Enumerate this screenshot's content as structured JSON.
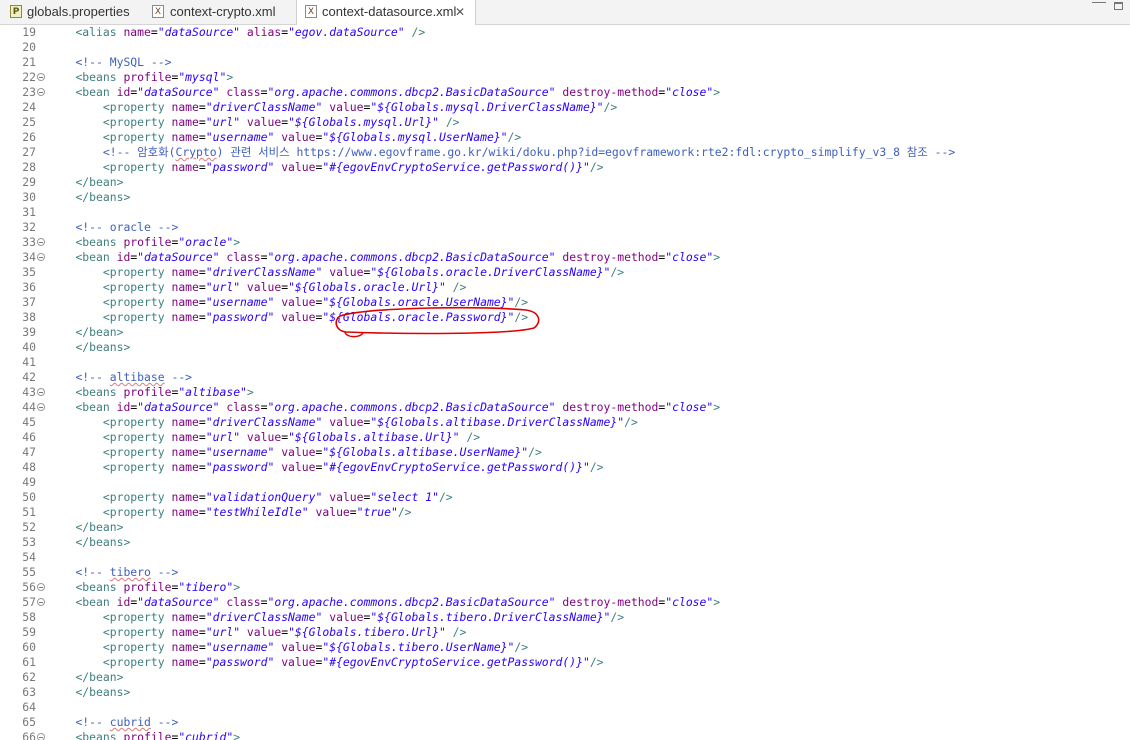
{
  "tabs": [
    {
      "label": "globals.properties",
      "icon": "properties-file-icon",
      "active": false
    },
    {
      "label": "context-crypto.xml",
      "icon": "xml-file-icon",
      "active": false
    },
    {
      "label": "context-datasource.xml",
      "icon": "xml-file-icon",
      "active": true,
      "close": "✕"
    }
  ],
  "editor": {
    "first_line": 19,
    "lines": [
      {
        "n": "19",
        "t": "    <alias name=\"dataSource\" alias=\"egov.dataSource\" />"
      },
      {
        "n": "20",
        "t": ""
      },
      {
        "n": "21",
        "t": "    <!-- MySQL -->"
      },
      {
        "n": "22",
        "t": "    <beans profile=\"mysql\">",
        "fold": true
      },
      {
        "n": "23",
        "t": "    <bean id=\"dataSource\" class=\"org.apache.commons.dbcp2.BasicDataSource\" destroy-method=\"close\">",
        "fold": true
      },
      {
        "n": "24",
        "t": "        <property name=\"driverClassName\" value=\"${Globals.mysql.DriverClassName}\"/>"
      },
      {
        "n": "25",
        "t": "        <property name=\"url\" value=\"${Globals.mysql.Url}\" />"
      },
      {
        "n": "26",
        "t": "        <property name=\"username\" value=\"${Globals.mysql.UserName}\"/>"
      },
      {
        "n": "27",
        "t": "        <!-- 암호화(Crypto) 관련 서비스 https://www.egovframe.go.kr/wiki/doku.php?id=egovframework:rte2:fdl:crypto_simplify_v3_8 참조 -->"
      },
      {
        "n": "28",
        "t": "        <property name=\"password\" value=\"#{egovEnvCryptoService.getPassword()}\"/>"
      },
      {
        "n": "29",
        "t": "    </bean>"
      },
      {
        "n": "30",
        "t": "    </beans>"
      },
      {
        "n": "31",
        "t": ""
      },
      {
        "n": "32",
        "t": "    <!-- oracle -->"
      },
      {
        "n": "33",
        "t": "    <beans profile=\"oracle\">",
        "fold": true
      },
      {
        "n": "34",
        "t": "    <bean id=\"dataSource\" class=\"org.apache.commons.dbcp2.BasicDataSource\" destroy-method=\"close\">",
        "fold": true
      },
      {
        "n": "35",
        "t": "        <property name=\"driverClassName\" value=\"${Globals.oracle.DriverClassName}\"/>"
      },
      {
        "n": "36",
        "t": "        <property name=\"url\" value=\"${Globals.oracle.Url}\" />"
      },
      {
        "n": "37",
        "t": "        <property name=\"username\" value=\"${Globals.oracle.UserName}\"/>"
      },
      {
        "n": "38",
        "t": "        <property name=\"password\" value=\"${Globals.oracle.Password}\"/>"
      },
      {
        "n": "39",
        "t": "    </bean>"
      },
      {
        "n": "40",
        "t": "    </beans>"
      },
      {
        "n": "41",
        "t": ""
      },
      {
        "n": "42",
        "t": "    <!-- altibase -->"
      },
      {
        "n": "43",
        "t": "    <beans profile=\"altibase\">",
        "fold": true
      },
      {
        "n": "44",
        "t": "    <bean id=\"dataSource\" class=\"org.apache.commons.dbcp2.BasicDataSource\" destroy-method=\"close\">",
        "fold": true
      },
      {
        "n": "45",
        "t": "        <property name=\"driverClassName\" value=\"${Globals.altibase.DriverClassName}\"/>"
      },
      {
        "n": "46",
        "t": "        <property name=\"url\" value=\"${Globals.altibase.Url}\" />"
      },
      {
        "n": "47",
        "t": "        <property name=\"username\" value=\"${Globals.altibase.UserName}\"/>"
      },
      {
        "n": "48",
        "t": "        <property name=\"password\" value=\"#{egovEnvCryptoService.getPassword()}\"/>"
      },
      {
        "n": "49",
        "t": ""
      },
      {
        "n": "50",
        "t": "        <property name=\"validationQuery\" value=\"select 1\"/>"
      },
      {
        "n": "51",
        "t": "        <property name=\"testWhileIdle\" value=\"true\"/>"
      },
      {
        "n": "52",
        "t": "    </bean>"
      },
      {
        "n": "53",
        "t": "    </beans>"
      },
      {
        "n": "54",
        "t": ""
      },
      {
        "n": "55",
        "t": "    <!-- tibero -->"
      },
      {
        "n": "56",
        "t": "    <beans profile=\"tibero\">",
        "fold": true
      },
      {
        "n": "57",
        "t": "    <bean id=\"dataSource\" class=\"org.apache.commons.dbcp2.BasicDataSource\" destroy-method=\"close\">",
        "fold": true
      },
      {
        "n": "58",
        "t": "        <property name=\"driverClassName\" value=\"${Globals.tibero.DriverClassName}\"/>"
      },
      {
        "n": "59",
        "t": "        <property name=\"url\" value=\"${Globals.tibero.Url}\" />"
      },
      {
        "n": "60",
        "t": "        <property name=\"username\" value=\"${Globals.tibero.UserName}\"/>"
      },
      {
        "n": "61",
        "t": "        <property name=\"password\" value=\"#{egovEnvCryptoService.getPassword()}\"/>"
      },
      {
        "n": "62",
        "t": "    </bean>"
      },
      {
        "n": "63",
        "t": "    </beans>"
      },
      {
        "n": "64",
        "t": ""
      },
      {
        "n": "65",
        "t": "    <!-- cubrid -->"
      },
      {
        "n": "66",
        "t": "    <beans profile=\"cubrid\">",
        "fold": true
      }
    ]
  },
  "colors": {
    "tag": "#3f7f7f",
    "attribute": "#7f007f",
    "value": "#2a00ff",
    "comment": "#3f5fbf",
    "annotation": "#e00000"
  }
}
